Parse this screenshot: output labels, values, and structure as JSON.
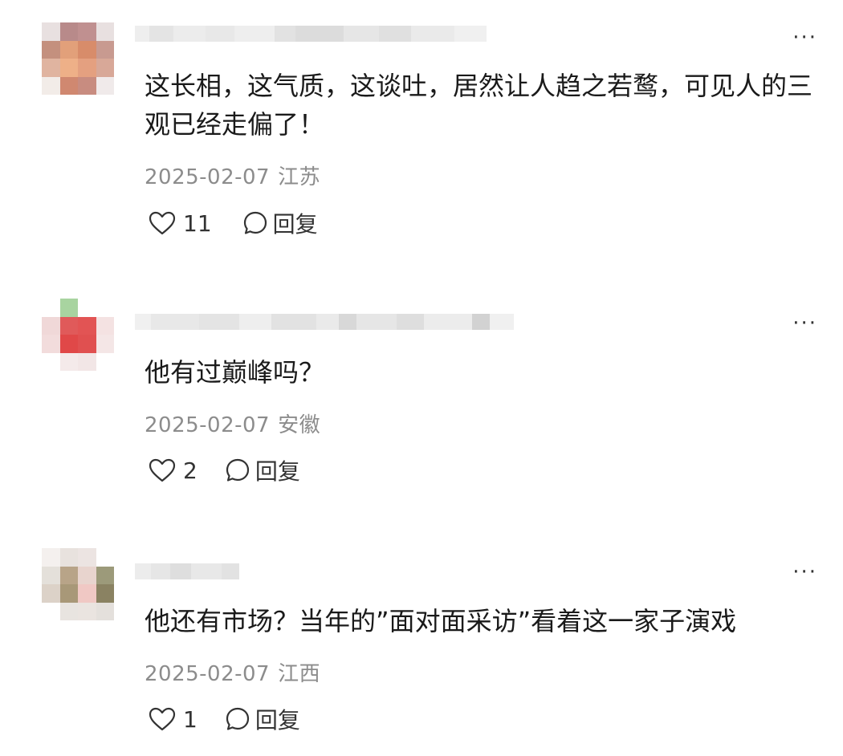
{
  "comments": [
    {
      "text": "这长相，这气质，这谈吐，居然让人趋之若鹜，可见人的三观已经走偏了！",
      "date": "2025-02-07",
      "location": "江苏",
      "likes": "11",
      "reply_label": "回复",
      "more_label": "···"
    },
    {
      "text": "他有过巅峰吗？",
      "date": "2025-02-07",
      "location": "安徽",
      "likes": "2",
      "reply_label": "回复",
      "more_label": "···"
    },
    {
      "text": "他还有市场？当年的”面对面采访”看着这一家子演戏",
      "date": "2025-02-07",
      "location": "江西",
      "likes": "1",
      "reply_label": "回复",
      "more_label": "···"
    }
  ]
}
